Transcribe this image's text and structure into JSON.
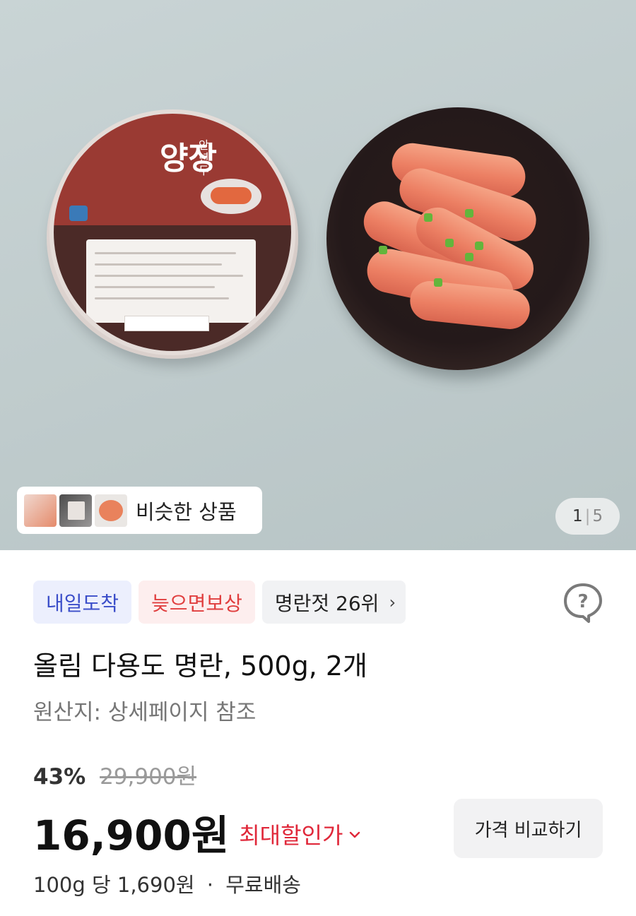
{
  "gallery": {
    "jar_title": "양장",
    "jar_subtitle": "안년두",
    "similar_label": "비슷한 상품",
    "counter_current": "1",
    "counter_separator": "|",
    "counter_total": "5",
    "icons": [
      "similar-thumb-1",
      "similar-thumb-2",
      "similar-thumb-3"
    ]
  },
  "tags": {
    "arrival": "내일도착",
    "guarantee": "늦으면보상",
    "rank": "명란젓 26위",
    "rank_chevron": "›"
  },
  "product": {
    "title": "올림 다용도 명란, 500g, 2개",
    "origin": "원산지: 상세페이지 참조"
  },
  "pricing": {
    "discount": "43%",
    "original_price": "29,900원",
    "price": "16,900원",
    "max_discount_label": "최대할인가",
    "compare_button": "가격 비교하기",
    "unit_price": "100g 당 1,690원",
    "separator": "·",
    "shipping": "무료배송"
  },
  "colors": {
    "tag_blue_text": "#3b4ec9",
    "tag_red_text": "#e03e3e",
    "max_discount": "#e0283a"
  }
}
